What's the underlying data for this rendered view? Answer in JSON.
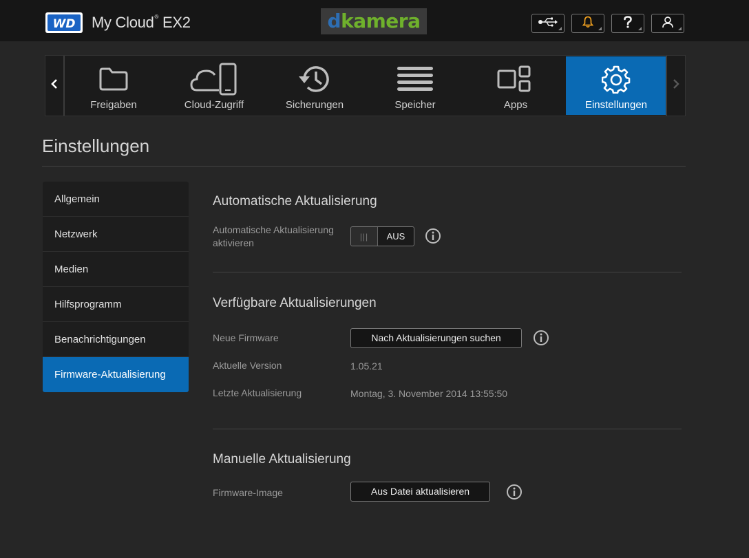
{
  "header": {
    "logo_text": "WD",
    "app_title": "My Cloud",
    "app_title_mark": "®",
    "app_title_model": "EX2",
    "brand_d": "d",
    "brand_rest": "kamera",
    "icons": [
      "usb-icon",
      "bell-icon",
      "help-icon",
      "user-icon"
    ],
    "accent_bell": "#f0a020"
  },
  "nav": {
    "items": [
      {
        "label": "Freigaben",
        "icon": "folder-icon"
      },
      {
        "label": "Cloud-Zugriff",
        "icon": "cloud-access-icon"
      },
      {
        "label": "Sicherungen",
        "icon": "history-icon"
      },
      {
        "label": "Speicher",
        "icon": "storage-icon"
      },
      {
        "label": "Apps",
        "icon": "apps-icon"
      },
      {
        "label": "Einstellungen",
        "icon": "gear-icon",
        "active": true
      }
    ],
    "active_color": "#0a6ab4"
  },
  "page_title": "Einstellungen",
  "sidebar": {
    "items": [
      {
        "label": "Allgemein"
      },
      {
        "label": "Netzwerk"
      },
      {
        "label": "Medien"
      },
      {
        "label": "Hilfsprogramm"
      },
      {
        "label": "Benachrichtigungen"
      },
      {
        "label": "Firmware-Aktualisierung",
        "active": true
      }
    ]
  },
  "auto_update": {
    "title": "Automatische Aktualisierung",
    "label_line1": "Automatische Aktualisierung",
    "label_line2": "aktivieren",
    "toggle_knob": "|||",
    "toggle_state": "AUS"
  },
  "available_updates": {
    "title": "Verfügbare Aktualisierungen",
    "new_firmware_label": "Neue Firmware",
    "check_button": "Nach Aktualisierungen suchen",
    "current_version_label": "Aktuelle Version",
    "current_version": "1.05.21",
    "last_update_label": "Letzte Aktualisierung",
    "last_update": "Montag, 3. November 2014 13:55:50"
  },
  "manual_update": {
    "title": "Manuelle Aktualisierung",
    "image_label": "Firmware-Image",
    "file_button": "Aus Datei aktualisieren"
  }
}
